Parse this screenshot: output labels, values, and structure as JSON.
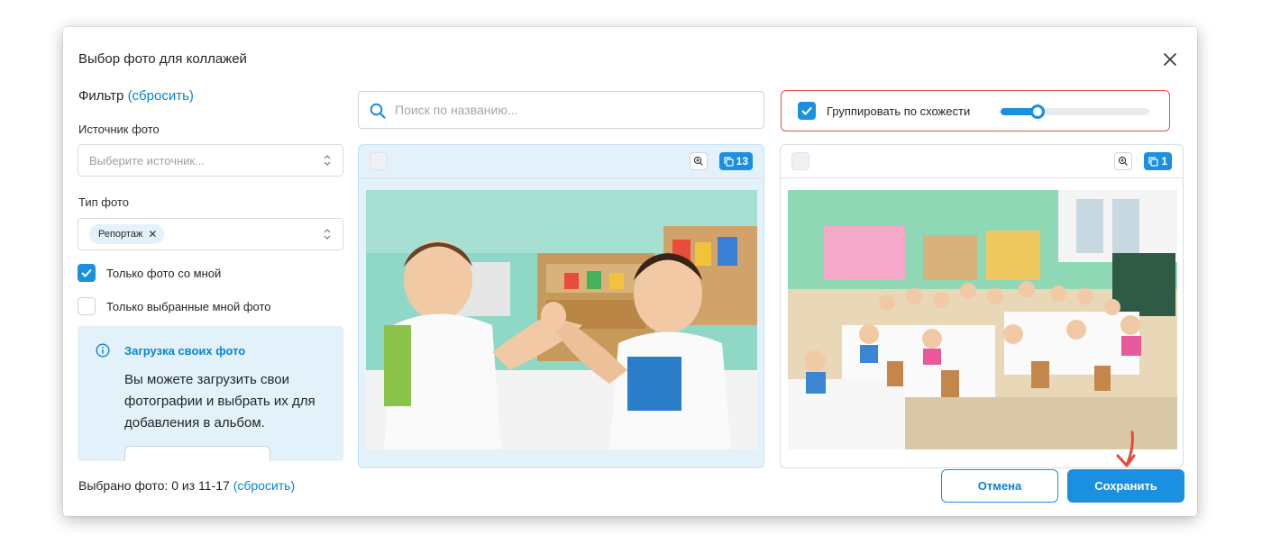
{
  "modal": {
    "title": "Выбор фото для коллажей"
  },
  "filter": {
    "title": "Фильтр",
    "reset_label": "(сбросить)",
    "source_label": "Источник фото",
    "source_placeholder": "Выберите источник...",
    "type_label": "Тип фото",
    "type_selected_tag": "Репортаж",
    "only_with_me": {
      "label": "Только фото со мной",
      "checked": true
    },
    "only_selected": {
      "label": "Только выбранные мной фото",
      "checked": false
    }
  },
  "upload_info": {
    "title": "Загрузка своих фото",
    "text": "Вы можете загрузить свои фотографии и выбрать их для добавления в альбом."
  },
  "search": {
    "placeholder": "Поиск по названию..."
  },
  "grouping": {
    "label": "Группировать по схожести",
    "checked": true,
    "slider_level": 0.25
  },
  "cards": [
    {
      "count": "13",
      "selected": false,
      "icon": "photo-two-boys-armwrestling"
    },
    {
      "count": "1",
      "selected": false,
      "icon": "photo-kids-at-tables"
    }
  ],
  "footer": {
    "selected_text": "Выбрано фото: 0 из 11-17",
    "reset_label": "(сбросить)",
    "cancel_label": "Отмена",
    "save_label": "Сохранить"
  },
  "colors": {
    "accent": "#1b8fe0",
    "link": "#0a84d6",
    "highlight_border": "#e0524d",
    "info_bg": "#e3f1fb"
  }
}
